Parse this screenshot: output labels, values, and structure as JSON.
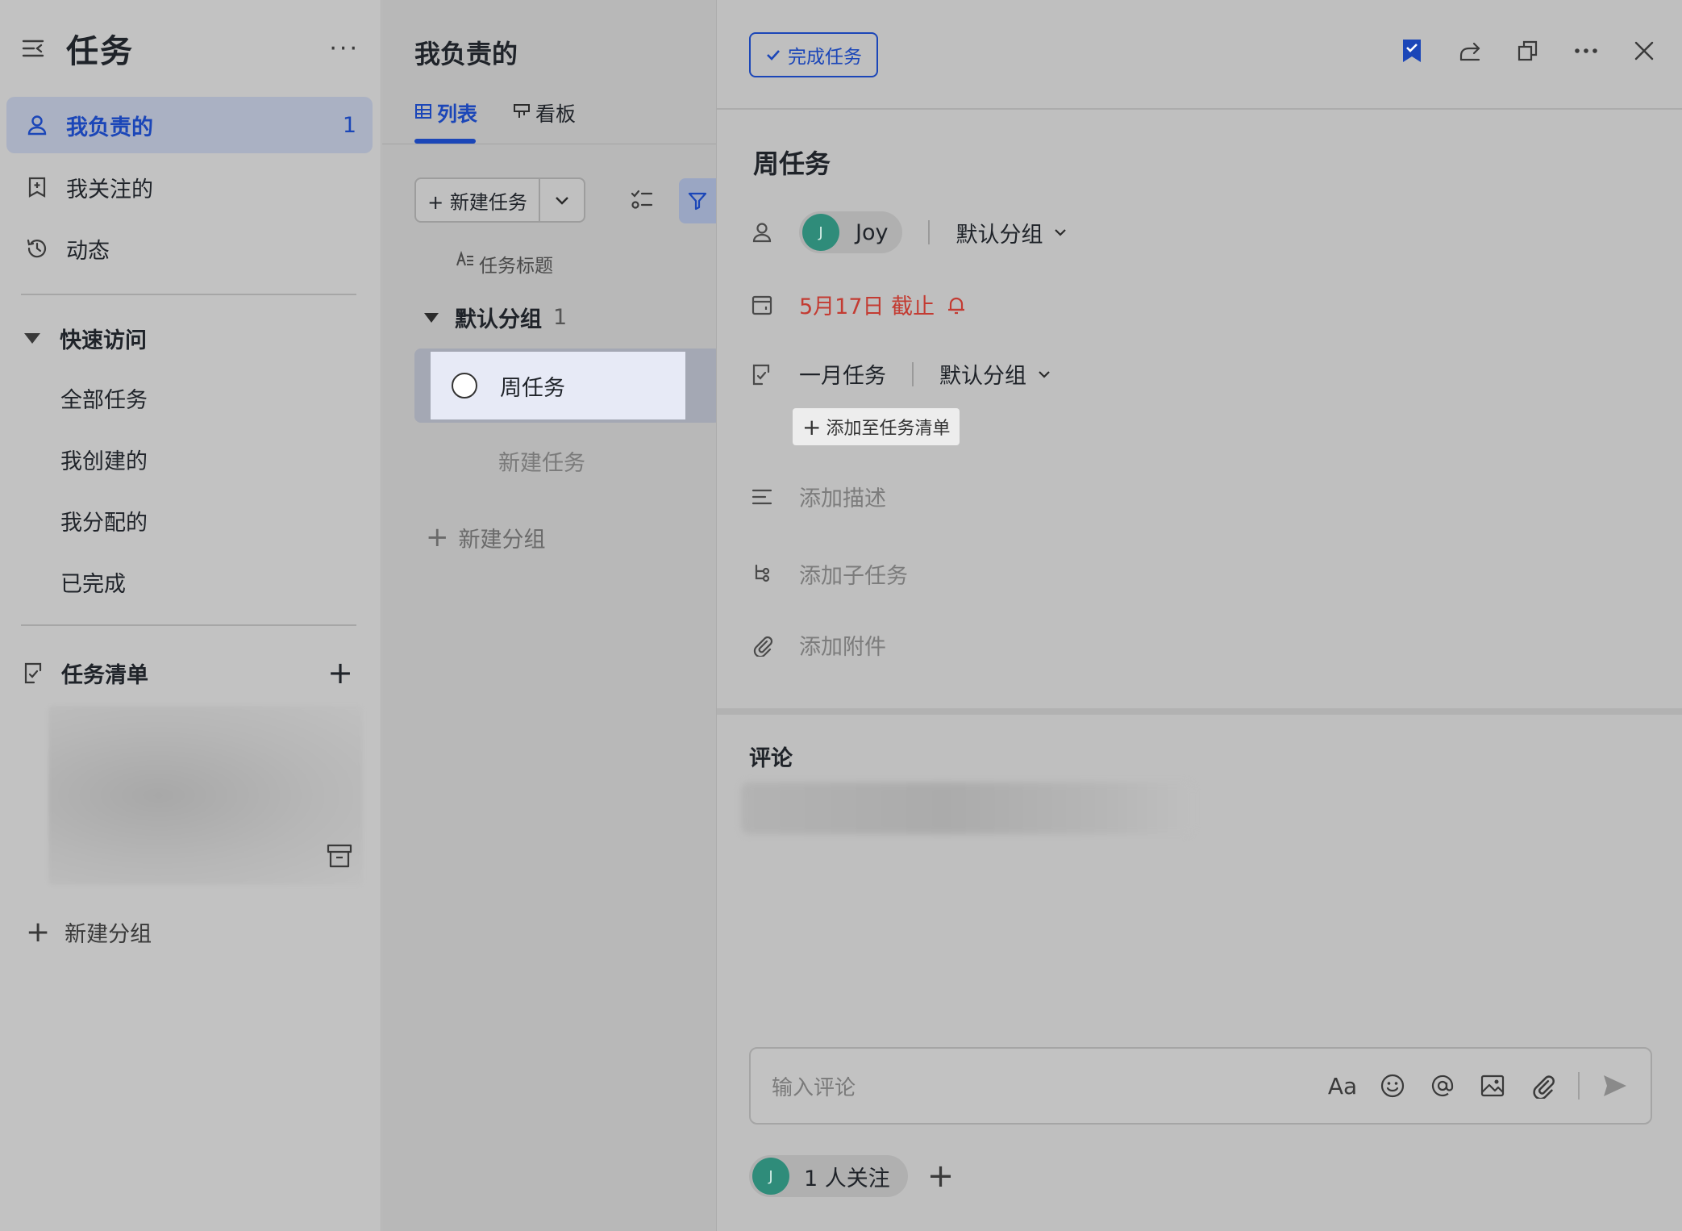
{
  "sidebar": {
    "title": "任务",
    "more": "···",
    "nav": [
      {
        "label": "我负责的",
        "count": "1"
      },
      {
        "label": "我关注的"
      },
      {
        "label": "动态"
      }
    ],
    "quick_access": {
      "title": "快速访问",
      "items": [
        "全部任务",
        "我创建的",
        "我分配的",
        "已完成"
      ]
    },
    "task_lists": {
      "title": "任务清单",
      "add": "+"
    },
    "new_group": "新建分组"
  },
  "list_pane": {
    "title": "我负责的",
    "tabs": [
      {
        "label": "列表"
      },
      {
        "label": "看板"
      }
    ],
    "new_task_button": "+ 新建任务",
    "column_header": "任务标题",
    "group": {
      "name": "默认分组",
      "count": "1"
    },
    "tasks": [
      {
        "title": "周任务"
      }
    ],
    "new_task_link": "新建任务",
    "new_group": "新建分组"
  },
  "detail": {
    "complete_button": "完成任务",
    "title": "周任务",
    "assignee": {
      "name": "Joy",
      "initial": "J"
    },
    "group": "默认分组",
    "due": "5月17日 截止",
    "task_list": {
      "name": "一月任务",
      "group": "默认分组"
    },
    "add_to_list": "添加至任务清单",
    "add_description": "添加描述",
    "add_subtask": "添加子任务",
    "add_attachment": "添加附件",
    "comments_title": "评论",
    "comment_placeholder": "输入评论",
    "font_tool": "Aa",
    "followers": {
      "label": "1 人关注",
      "initial": "J"
    }
  },
  "colors": {
    "accent": "#1b46b8",
    "due_red": "#c33b32",
    "avatar": "#2f8c7a"
  }
}
